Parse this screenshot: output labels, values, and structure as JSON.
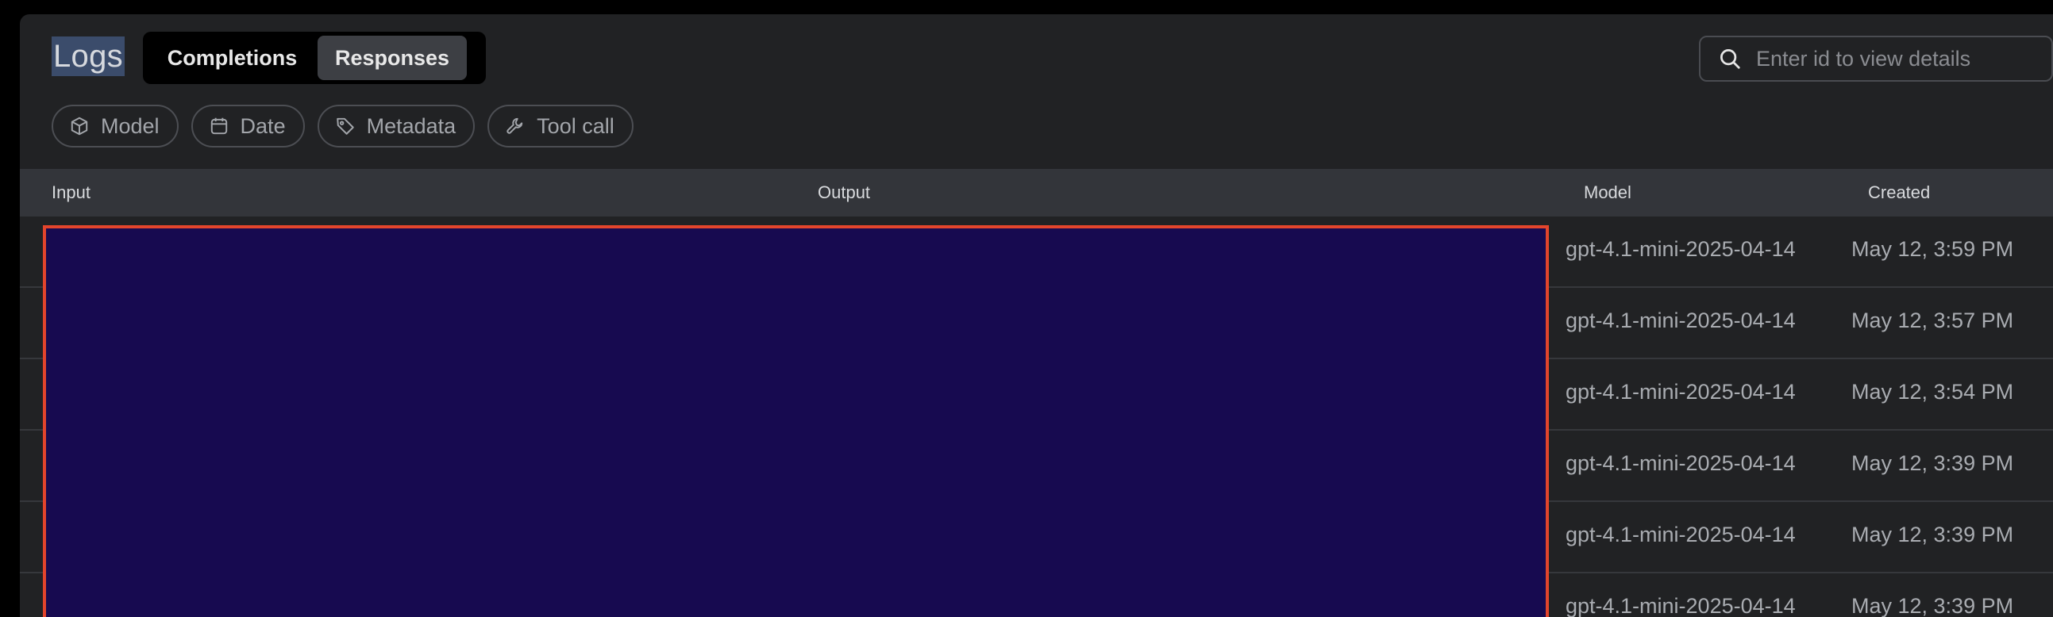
{
  "header": {
    "title": "Logs",
    "tabs": [
      {
        "label": "Completions",
        "active": false
      },
      {
        "label": "Responses",
        "active": true
      }
    ],
    "search": {
      "placeholder": "Enter id to view details",
      "value": ""
    }
  },
  "filters": [
    {
      "label": "Model",
      "icon": "cube-icon"
    },
    {
      "label": "Date",
      "icon": "calendar-icon"
    },
    {
      "label": "Metadata",
      "icon": "tag-icon"
    },
    {
      "label": "Tool call",
      "icon": "wrench-icon"
    }
  ],
  "table": {
    "columns": {
      "input": "Input",
      "output": "Output",
      "model": "Model",
      "created": "Created"
    },
    "rows": [
      {
        "model": "gpt-4.1-mini-2025-04-14",
        "created": "May 12, 3:59 PM"
      },
      {
        "model": "gpt-4.1-mini-2025-04-14",
        "created": "May 12, 3:57 PM"
      },
      {
        "model": "gpt-4.1-mini-2025-04-14",
        "created": "May 12, 3:54 PM"
      },
      {
        "model": "gpt-4.1-mini-2025-04-14",
        "created": "May 12, 3:39 PM"
      },
      {
        "model": "gpt-4.1-mini-2025-04-14",
        "created": "May 12, 3:39 PM"
      },
      {
        "model": "gpt-4.1-mini-2025-04-14",
        "created": "May 12, 3:39 PM"
      }
    ]
  },
  "colors": {
    "background": "#212224",
    "header_row": "#33353a",
    "redaction_fill": "#170a50",
    "redaction_border": "#e2452c",
    "title_highlight": "#3b4c6b"
  }
}
